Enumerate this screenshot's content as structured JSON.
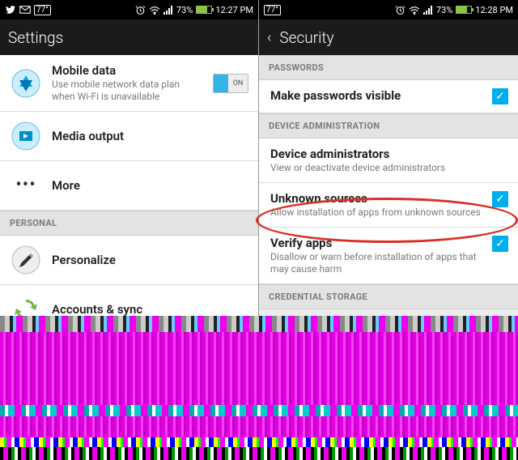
{
  "left": {
    "status": {
      "temp": "77°",
      "battery_pct": "73%",
      "time": "12:27 PM"
    },
    "title": "Settings",
    "items": [
      {
        "title": "Mobile data",
        "sub": "Use mobile network data plan when Wi-Fi is unavailable",
        "toggle": "ON"
      },
      {
        "title": "Media output"
      },
      {
        "title": "More"
      }
    ],
    "section_personal": "PERSONAL",
    "personal_items": [
      {
        "title": "Personalize"
      },
      {
        "title": "Accounts & sync"
      }
    ]
  },
  "right": {
    "status": {
      "temp": "77°",
      "battery_pct": "73%",
      "time": "12:28 PM"
    },
    "title": "Security",
    "section_passwords": "PASSWORDS",
    "passwords_items": [
      {
        "title": "Make passwords visible",
        "checked": true
      }
    ],
    "section_device_admin": "DEVICE ADMINISTRATION",
    "device_admin_items": [
      {
        "title": "Device administrators",
        "sub": "View or deactivate device administrators"
      },
      {
        "title": "Unknown sources",
        "sub": "Allow installation of apps from unknown sources",
        "checked": true
      },
      {
        "title": "Verify apps",
        "sub": "Disallow or warn before installation of apps that may cause harm",
        "checked": true
      }
    ],
    "section_cred": "CREDENTIAL STORAGE"
  },
  "highlight": {
    "target": "Unknown sources"
  }
}
